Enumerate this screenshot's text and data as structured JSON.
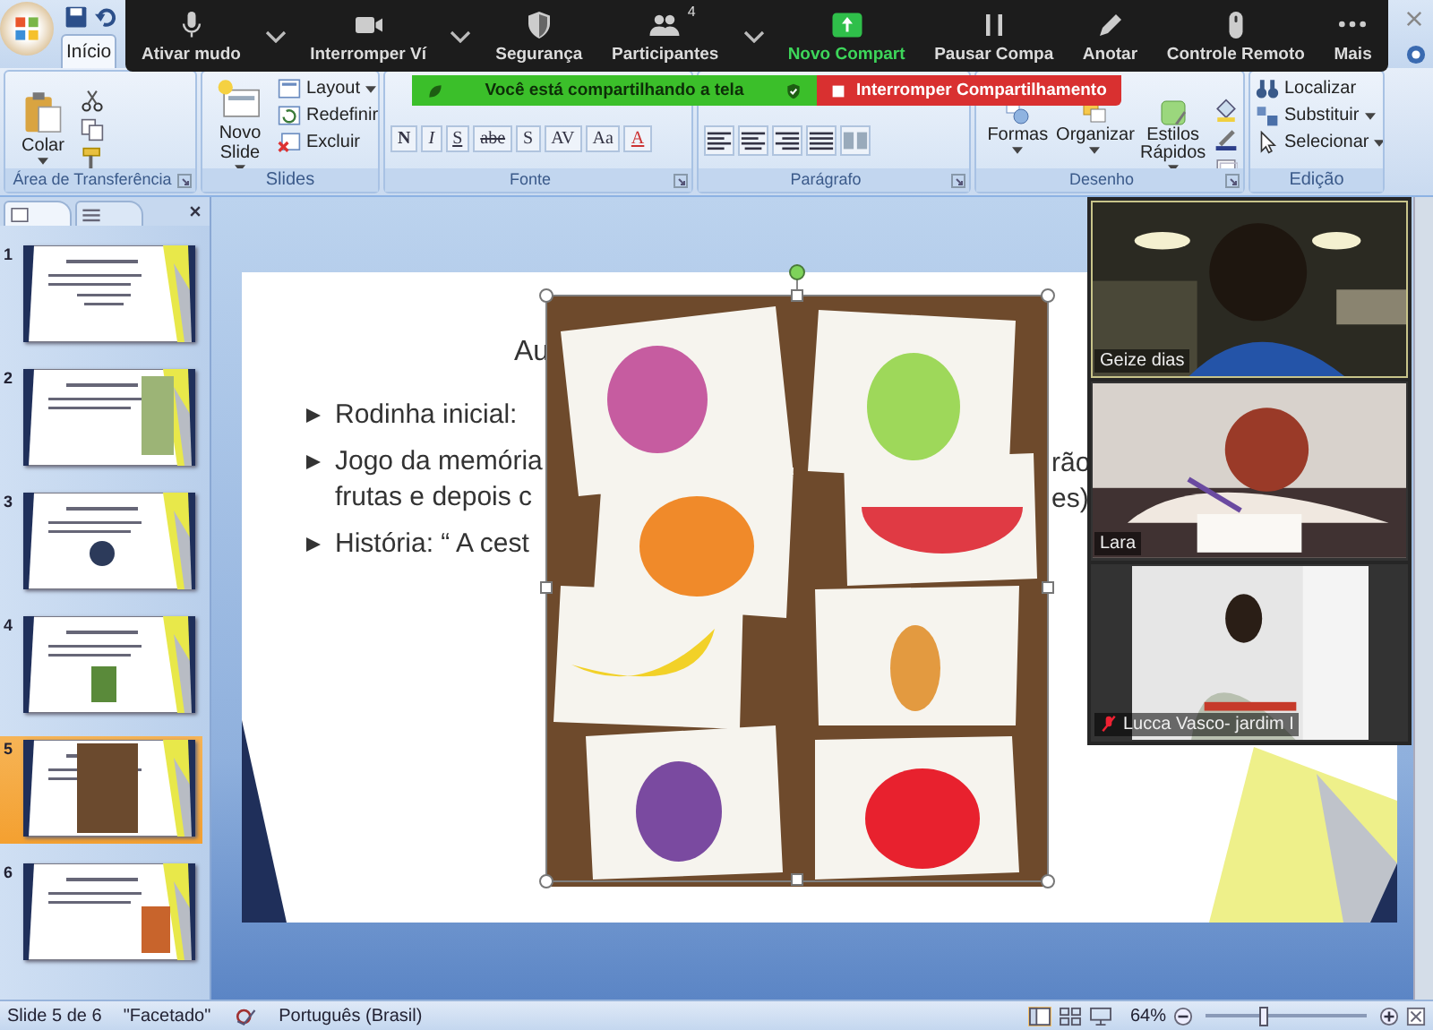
{
  "ribbon": {
    "tabs": [
      {
        "label": "Início",
        "selected": true
      }
    ],
    "groups": [
      {
        "kind": "clipboard",
        "label": "Área de Transferência",
        "launcher": true,
        "large": [
          {
            "label": "Colar",
            "menu": true
          }
        ]
      },
      {
        "kind": "slides",
        "label": "Slides",
        "launcher": false,
        "large": [
          {
            "label": "Novo Slide",
            "menu": true
          }
        ],
        "small": [
          {
            "label": "Layout",
            "menu": true
          },
          {
            "label": "Redefinir",
            "menu": false
          },
          {
            "label": "Excluir",
            "menu": false
          }
        ]
      },
      {
        "kind": "font",
        "label": "Fonte",
        "launcher": true,
        "glyphs": [
          "N",
          "I",
          "S",
          "abe",
          "S",
          "AV",
          "Aa",
          "A"
        ]
      },
      {
        "kind": "paragraph",
        "label": "Parágrafo",
        "launcher": true
      },
      {
        "kind": "drawing",
        "label": "Desenho",
        "launcher": true,
        "large": [
          {
            "label": "Formas",
            "menu": true
          },
          {
            "label": "Organizar",
            "menu": true
          },
          {
            "label": "Estilos Rápidos",
            "menu": true
          }
        ]
      },
      {
        "kind": "editing",
        "label": "Edição",
        "launcher": false,
        "small": [
          {
            "label": "Localizar",
            "menu": false
          },
          {
            "label": "Substituir",
            "menu": true
          },
          {
            "label": "Selecionar",
            "menu": true
          }
        ]
      }
    ]
  },
  "meeting_toolbar": {
    "items": [
      {
        "label": "Ativar mudo",
        "menu": true,
        "highlighted": false
      },
      {
        "label": "Interromper Ví",
        "menu": true,
        "highlighted": false
      },
      {
        "label": "Segurança",
        "menu": false,
        "highlighted": false
      },
      {
        "label": "Participantes",
        "count": "4",
        "menu": true,
        "highlighted": false
      },
      {
        "label": "Novo Compart",
        "menu": false,
        "highlighted": true
      },
      {
        "label": "Pausar Compa",
        "menu": false,
        "highlighted": false
      },
      {
        "label": "Anotar",
        "menu": false,
        "highlighted": false
      },
      {
        "label": "Controle Remoto",
        "menu": false,
        "highlighted": false
      },
      {
        "label": "Mais",
        "menu": false,
        "highlighted": false
      }
    ]
  },
  "share_banner": {
    "message": "Você está compartilhando a tela",
    "stop_button": "Interromper Compartilhamento"
  },
  "slides_panel": {
    "thumbnails": [
      {
        "number": "1",
        "selected": false
      },
      {
        "number": "2",
        "selected": false
      },
      {
        "number": "3",
        "selected": false
      },
      {
        "number": "4",
        "selected": false
      },
      {
        "number": "5",
        "selected": true
      },
      {
        "number": "6",
        "selected": false
      }
    ]
  },
  "slide": {
    "title": "Au",
    "bullets": [
      {
        "lines": [
          "Rodinha inicial:"
        ]
      },
      {
        "lines": [
          "Jogo da memória",
          "frutas e depois c"
        ],
        "right": [
          "rão",
          "es)"
        ]
      },
      {
        "lines": [
          "História: “ A cest"
        ]
      }
    ],
    "image": {
      "selected": true
    }
  },
  "video_panel": {
    "tiles": [
      {
        "name": "Geize dias",
        "muted": false,
        "speaking": true
      },
      {
        "name": "Lara",
        "muted": false,
        "speaking": false
      },
      {
        "name": "Lucca Vasco- jardim I",
        "muted": true,
        "speaking": false
      }
    ]
  },
  "status_bar": {
    "slide": "Slide 5 de 6",
    "theme": "\"Facetado\"",
    "language": "Português (Brasil)",
    "zoom": "64%",
    "zoom_slider": {
      "level": 0.36
    }
  }
}
